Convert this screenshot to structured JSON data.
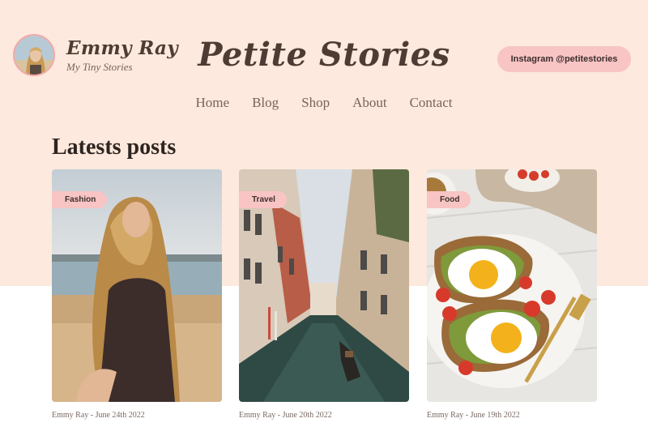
{
  "brand": {
    "name": "Emmy Ray",
    "tagline": "My Tiny Stories"
  },
  "site_title": "Petite Stories",
  "instagram_button": "Instagram @petitestories",
  "nav": {
    "items": [
      "Home",
      "Blog",
      "Shop",
      "About",
      "Contact"
    ]
  },
  "section": {
    "title": "Latests posts"
  },
  "posts": [
    {
      "category": "Fashion",
      "meta": "Emmy Ray - June 24th 2022",
      "image": "beach-portrait"
    },
    {
      "category": "Travel",
      "meta": "Emmy Ray - June 20th 2022",
      "image": "venice-canal"
    },
    {
      "category": "Food",
      "meta": "Emmy Ray - June 19th 2022",
      "image": "avocado-egg-toast"
    }
  ],
  "colors": {
    "hero_background": "#fde9dd",
    "accent_pink": "#f8c4c4",
    "text_brown": "#4e3c34"
  }
}
